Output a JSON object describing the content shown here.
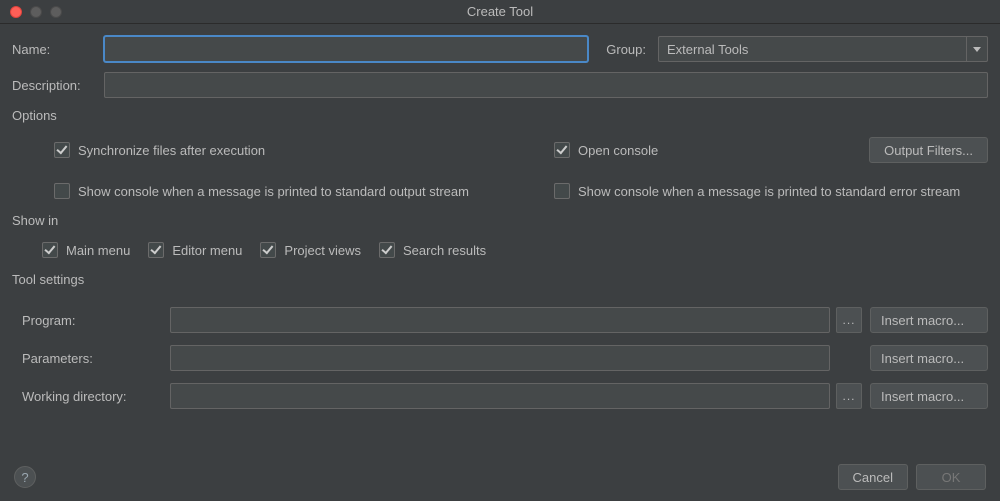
{
  "window": {
    "title": "Create Tool"
  },
  "form": {
    "name_label": "Name:",
    "name_value": "",
    "group_label": "Group:",
    "group_value": "External Tools",
    "description_label": "Description:",
    "description_value": ""
  },
  "options": {
    "section_title": "Options",
    "sync_label": "Synchronize files after execution",
    "sync_checked": true,
    "open_console_label": "Open console",
    "open_console_checked": true,
    "output_filters_label": "Output Filters...",
    "stdout_label": "Show console when a message is printed to standard output stream",
    "stdout_checked": false,
    "stderr_label": "Show console when a message is printed to standard error stream",
    "stderr_checked": false
  },
  "showin": {
    "section_title": "Show in",
    "main_menu_label": "Main menu",
    "main_menu_checked": true,
    "editor_menu_label": "Editor menu",
    "editor_menu_checked": true,
    "project_views_label": "Project views",
    "project_views_checked": true,
    "search_results_label": "Search results",
    "search_results_checked": true
  },
  "tool_settings": {
    "section_title": "Tool settings",
    "program_label": "Program:",
    "program_value": "",
    "parameters_label": "Parameters:",
    "parameters_value": "",
    "workdir_label": "Working directory:",
    "workdir_value": "",
    "browse_label": "...",
    "insert_macro_label": "Insert macro..."
  },
  "footer": {
    "help_label": "?",
    "cancel_label": "Cancel",
    "ok_label": "OK"
  }
}
